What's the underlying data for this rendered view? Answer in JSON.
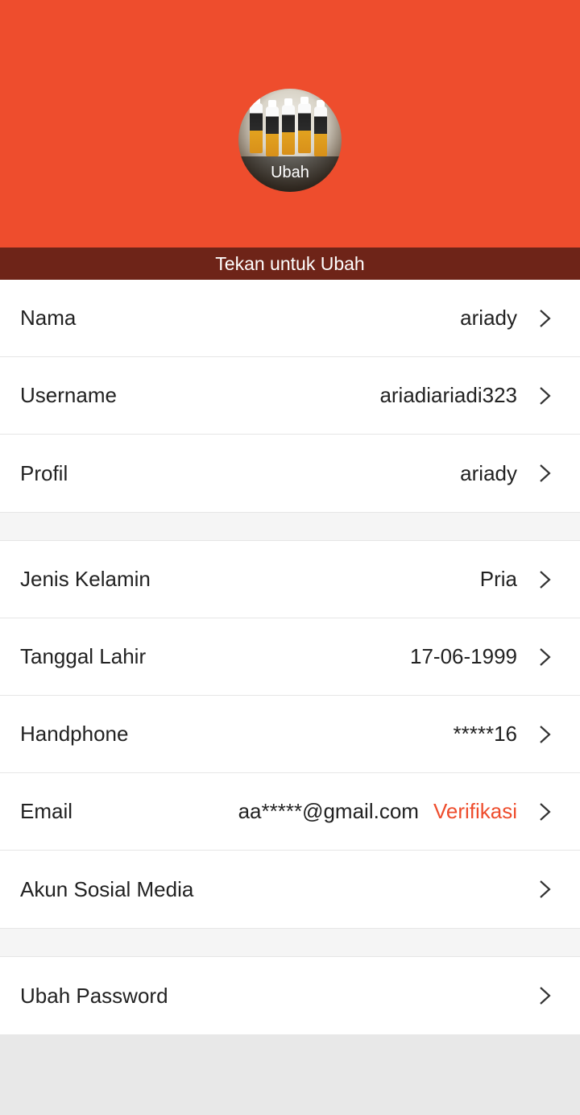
{
  "header": {
    "avatar_label": "Ubah",
    "hint": "Tekan untuk Ubah",
    "bg_color": "#ee4d2d",
    "hint_bg_color": "#6e2418"
  },
  "groups": [
    {
      "rows": [
        {
          "label": "Nama",
          "value": "ariady"
        },
        {
          "label": "Username",
          "value": "ariadiariadi323"
        },
        {
          "label": "Profil",
          "value": "ariady"
        }
      ]
    },
    {
      "rows": [
        {
          "label": "Jenis Kelamin",
          "value": "Pria"
        },
        {
          "label": "Tanggal Lahir",
          "value": "17-06-1999"
        },
        {
          "label": "Handphone",
          "value": "*****16"
        },
        {
          "label": "Email",
          "value": "aa*****@gmail.com",
          "action": "Verifikasi"
        },
        {
          "label": "Akun Sosial Media",
          "value": ""
        }
      ]
    },
    {
      "rows": [
        {
          "label": "Ubah Password",
          "value": ""
        }
      ]
    }
  ],
  "accent_color": "#ee4d2d",
  "icons": {
    "chevron": "chevron-right-icon"
  }
}
